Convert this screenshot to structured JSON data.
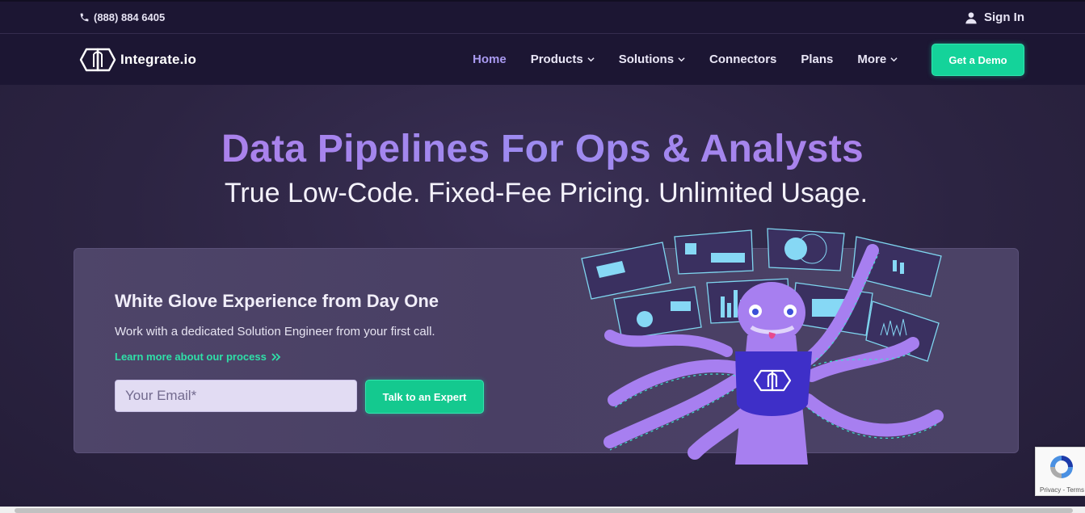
{
  "topbar": {
    "phone": "(888) 884 6405",
    "signin": "Sign In"
  },
  "nav": {
    "brand": "Integrate.io",
    "items": [
      {
        "label": "Home"
      },
      {
        "label": "Products"
      },
      {
        "label": "Solutions"
      },
      {
        "label": "Connectors"
      },
      {
        "label": "Plans"
      },
      {
        "label": "More"
      }
    ],
    "cta": "Get a Demo"
  },
  "hero": {
    "title": "Data Pipelines For Ops & Analysts",
    "subtitle": "True Low-Code. Fixed-Fee Pricing. Unlimited Usage."
  },
  "card": {
    "title": "White Glove Experience from Day One",
    "text": "Work with a dedicated Solution Engineer from your first call.",
    "link": "Learn more about our process",
    "email_placeholder": "Your Email*",
    "button": "Talk to an Expert"
  },
  "recaptcha": {
    "text": "Privacy - Terms"
  },
  "colors": {
    "accent_green": "#14d39a",
    "nav_active": "#a99af0",
    "title_purple": "#a27ee8",
    "link_green": "#2fe0a8"
  },
  "icons": [
    "phone-icon",
    "user-icon",
    "logo-icon",
    "chevron-down-icon",
    "double-chevron-right-icon",
    "recaptcha-icon"
  ]
}
